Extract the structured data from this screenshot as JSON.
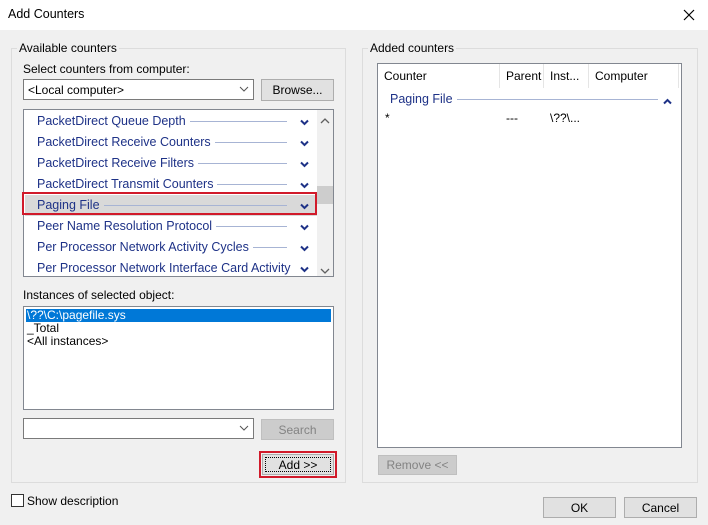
{
  "window": {
    "title": "Add Counters",
    "close_icon": "close-icon"
  },
  "available": {
    "legend": "Available counters",
    "computer_label": "Select counters from computer:",
    "computer_value": "<Local computer>",
    "browse_label": "Browse...",
    "counters": [
      {
        "name": "PacketDirect Queue Depth",
        "expanded": false
      },
      {
        "name": "PacketDirect Receive Counters",
        "expanded": false
      },
      {
        "name": "PacketDirect Receive Filters",
        "expanded": false
      },
      {
        "name": "PacketDirect Transmit Counters",
        "expanded": false
      },
      {
        "name": "Paging File",
        "expanded": false,
        "selected": true
      },
      {
        "name": "Peer Name Resolution Protocol",
        "expanded": false
      },
      {
        "name": "Per Processor Network Activity Cycles",
        "expanded": false
      },
      {
        "name": "Per Processor Network Interface Card Activity",
        "expanded": false
      }
    ],
    "instances_label": "Instances of selected object:",
    "instances": [
      {
        "name": "\\??\\C:\\pagefile.sys",
        "selected": true
      },
      {
        "name": "_Total",
        "selected": false
      },
      {
        "name": "<All instances>",
        "selected": false
      }
    ],
    "search_value": "",
    "search_label": "Search",
    "add_label": "Add >>"
  },
  "added": {
    "legend": "Added counters",
    "columns": [
      "Counter",
      "Parent",
      "Inst...",
      "Computer"
    ],
    "group": "Paging File",
    "rows": [
      {
        "counter": "*",
        "parent": "---",
        "instance": "\\??\\...",
        "computer": ""
      }
    ],
    "remove_label": "Remove <<"
  },
  "footer": {
    "show_description_label": "Show description",
    "show_description_checked": false,
    "ok_label": "OK",
    "cancel_label": "Cancel"
  },
  "colors": {
    "category_text": "#1e3287",
    "selection_blue": "#0078d7",
    "highlight_red": "#d11a2a"
  }
}
